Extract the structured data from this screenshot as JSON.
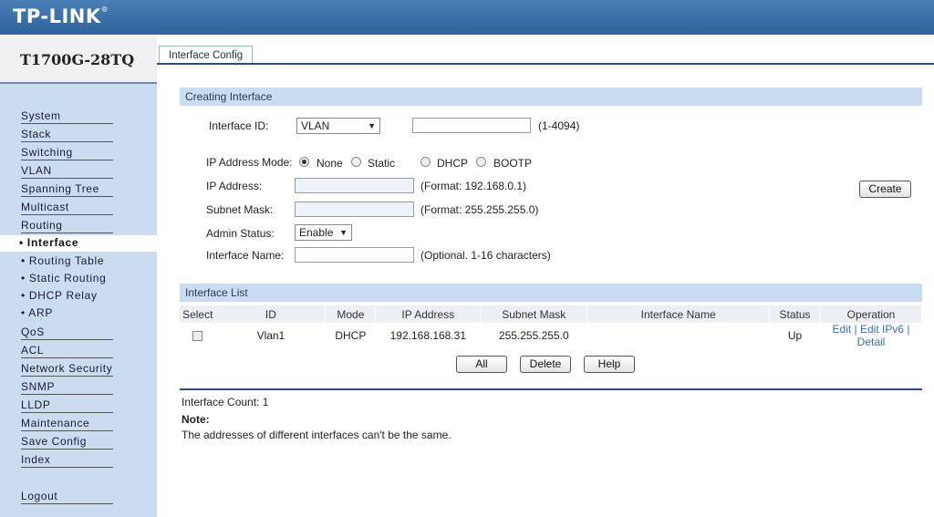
{
  "brand": "TP-LINK",
  "model": "T1700G-28TQ",
  "tab": "Interface Config",
  "sidebar": {
    "items": [
      "System",
      "Stack",
      "Switching",
      "VLAN",
      "Spanning Tree",
      "Multicast",
      "Routing"
    ],
    "active": "• Interface",
    "subs": [
      "• Routing Table",
      "• Static Routing",
      "• DHCP Relay",
      "• ARP"
    ],
    "items2": [
      "QoS",
      "ACL",
      "Network Security",
      "SNMP",
      "LLDP",
      "Maintenance",
      "Save Config",
      "Index"
    ],
    "logout": "Logout"
  },
  "create": {
    "title": "Creating Interface",
    "interface_id_label": "Interface ID:",
    "interface_id_type": "VLAN",
    "interface_id_range": "(1-4094)",
    "ip_mode_label": "IP Address Mode:",
    "modes": [
      "None",
      "Static",
      "DHCP",
      "BOOTP"
    ],
    "ip_label": "IP Address:",
    "ip_hint": "(Format: 192.168.0.1)",
    "mask_label": "Subnet Mask:",
    "mask_hint": "(Format: 255.255.255.0)",
    "admin_label": "Admin Status:",
    "admin_value": "Enable",
    "name_label": "Interface Name:",
    "name_hint": "(Optional. 1-16 characters)",
    "create_button": "Create"
  },
  "list": {
    "title": "Interface List",
    "columns": [
      "Select",
      "ID",
      "Mode",
      "IP Address",
      "Subnet Mask",
      "Interface Name",
      "Status",
      "Operation"
    ],
    "rows": [
      {
        "id": "Vlan1",
        "mode": "DHCP",
        "ip": "192.168.168.31",
        "mask": "255.255.255.0",
        "name": "",
        "status": "Up",
        "op1": "Edit | Edit IPv6 |",
        "op2": "Detail"
      }
    ],
    "buttons": {
      "all": "All",
      "delete": "Delete",
      "help": "Help"
    }
  },
  "footer": {
    "count": "Interface Count: 1",
    "note_title": "Note:",
    "note_text": "The addresses of different interfaces can't be the same."
  }
}
